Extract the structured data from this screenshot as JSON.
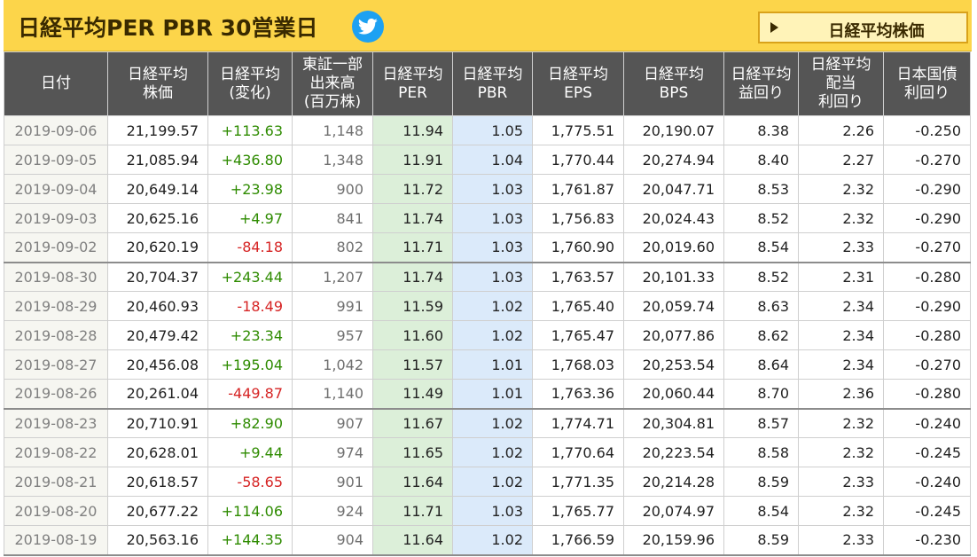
{
  "header": {
    "title": "日経平均PER PBR 30営業日",
    "nav_button_label": "日経平均株価",
    "share_icon": "twitter-icon"
  },
  "colors": {
    "header_bg": "#fcd54a",
    "column_header_bg": "#555555",
    "per_column_bg": "#dcefd9",
    "pbr_column_bg": "#dbeafa",
    "positive_change": "#2e8b00",
    "negative_change": "#d62424"
  },
  "table": {
    "columns": [
      [
        "日付"
      ],
      [
        "日経平均",
        "株価"
      ],
      [
        "日経平均",
        "(変化)"
      ],
      [
        "東証一部",
        "出来高",
        "(百万株)"
      ],
      [
        "日経平均",
        "PER"
      ],
      [
        "日経平均",
        "PBR"
      ],
      [
        "日経平均",
        "EPS"
      ],
      [
        "日経平均",
        "BPS"
      ],
      [
        "日経平均",
        "益回り"
      ],
      [
        "日経平均",
        "配当",
        "利回り"
      ],
      [
        "日本国債",
        "利回り"
      ]
    ],
    "rows": [
      {
        "date": "2019-09-06",
        "price": "21,199.57",
        "change": "+113.63",
        "volume": "1,148",
        "per": "11.94",
        "pbr": "1.05",
        "eps": "1,775.51",
        "bps": "20,190.07",
        "earnings_yield": "8.38",
        "dividend_yield": "2.26",
        "jgb_yield": "-0.250",
        "week_start": false
      },
      {
        "date": "2019-09-05",
        "price": "21,085.94",
        "change": "+436.80",
        "volume": "1,348",
        "per": "11.91",
        "pbr": "1.04",
        "eps": "1,770.44",
        "bps": "20,274.94",
        "earnings_yield": "8.40",
        "dividend_yield": "2.27",
        "jgb_yield": "-0.270",
        "week_start": false
      },
      {
        "date": "2019-09-04",
        "price": "20,649.14",
        "change": "+23.98",
        "volume": "900",
        "per": "11.72",
        "pbr": "1.03",
        "eps": "1,761.87",
        "bps": "20,047.71",
        "earnings_yield": "8.53",
        "dividend_yield": "2.32",
        "jgb_yield": "-0.290",
        "week_start": false
      },
      {
        "date": "2019-09-03",
        "price": "20,625.16",
        "change": "+4.97",
        "volume": "841",
        "per": "11.74",
        "pbr": "1.03",
        "eps": "1,756.83",
        "bps": "20,024.43",
        "earnings_yield": "8.52",
        "dividend_yield": "2.32",
        "jgb_yield": "-0.290",
        "week_start": false
      },
      {
        "date": "2019-09-02",
        "price": "20,620.19",
        "change": "-84.18",
        "volume": "802",
        "per": "11.71",
        "pbr": "1.03",
        "eps": "1,760.90",
        "bps": "20,019.60",
        "earnings_yield": "8.54",
        "dividend_yield": "2.33",
        "jgb_yield": "-0.270",
        "week_start": false
      },
      {
        "date": "2019-08-30",
        "price": "20,704.37",
        "change": "+243.44",
        "volume": "1,207",
        "per": "11.74",
        "pbr": "1.03",
        "eps": "1,763.57",
        "bps": "20,101.33",
        "earnings_yield": "8.52",
        "dividend_yield": "2.31",
        "jgb_yield": "-0.280",
        "week_start": true
      },
      {
        "date": "2019-08-29",
        "price": "20,460.93",
        "change": "-18.49",
        "volume": "991",
        "per": "11.59",
        "pbr": "1.02",
        "eps": "1,765.40",
        "bps": "20,059.74",
        "earnings_yield": "8.63",
        "dividend_yield": "2.34",
        "jgb_yield": "-0.290",
        "week_start": false
      },
      {
        "date": "2019-08-28",
        "price": "20,479.42",
        "change": "+23.34",
        "volume": "957",
        "per": "11.60",
        "pbr": "1.02",
        "eps": "1,765.47",
        "bps": "20,077.86",
        "earnings_yield": "8.62",
        "dividend_yield": "2.34",
        "jgb_yield": "-0.280",
        "week_start": false
      },
      {
        "date": "2019-08-27",
        "price": "20,456.08",
        "change": "+195.04",
        "volume": "1,042",
        "per": "11.57",
        "pbr": "1.01",
        "eps": "1,768.03",
        "bps": "20,253.54",
        "earnings_yield": "8.64",
        "dividend_yield": "2.34",
        "jgb_yield": "-0.270",
        "week_start": false
      },
      {
        "date": "2019-08-26",
        "price": "20,261.04",
        "change": "-449.87",
        "volume": "1,140",
        "per": "11.49",
        "pbr": "1.01",
        "eps": "1,763.36",
        "bps": "20,060.44",
        "earnings_yield": "8.70",
        "dividend_yield": "2.36",
        "jgb_yield": "-0.280",
        "week_start": false
      },
      {
        "date": "2019-08-23",
        "price": "20,710.91",
        "change": "+82.90",
        "volume": "907",
        "per": "11.67",
        "pbr": "1.02",
        "eps": "1,774.71",
        "bps": "20,304.81",
        "earnings_yield": "8.57",
        "dividend_yield": "2.32",
        "jgb_yield": "-0.240",
        "week_start": true
      },
      {
        "date": "2019-08-22",
        "price": "20,628.01",
        "change": "+9.44",
        "volume": "974",
        "per": "11.65",
        "pbr": "1.02",
        "eps": "1,770.64",
        "bps": "20,223.54",
        "earnings_yield": "8.58",
        "dividend_yield": "2.32",
        "jgb_yield": "-0.245",
        "week_start": false
      },
      {
        "date": "2019-08-21",
        "price": "20,618.57",
        "change": "-58.65",
        "volume": "901",
        "per": "11.64",
        "pbr": "1.02",
        "eps": "1,771.35",
        "bps": "20,214.28",
        "earnings_yield": "8.59",
        "dividend_yield": "2.33",
        "jgb_yield": "-0.240",
        "week_start": false
      },
      {
        "date": "2019-08-20",
        "price": "20,677.22",
        "change": "+114.06",
        "volume": "924",
        "per": "11.71",
        "pbr": "1.03",
        "eps": "1,765.77",
        "bps": "20,074.97",
        "earnings_yield": "8.54",
        "dividend_yield": "2.32",
        "jgb_yield": "-0.245",
        "week_start": false
      },
      {
        "date": "2019-08-19",
        "price": "20,563.16",
        "change": "+144.35",
        "volume": "904",
        "per": "11.64",
        "pbr": "1.02",
        "eps": "1,766.59",
        "bps": "20,159.96",
        "earnings_yield": "8.59",
        "dividend_yield": "2.33",
        "jgb_yield": "-0.230",
        "week_start": false
      }
    ]
  }
}
